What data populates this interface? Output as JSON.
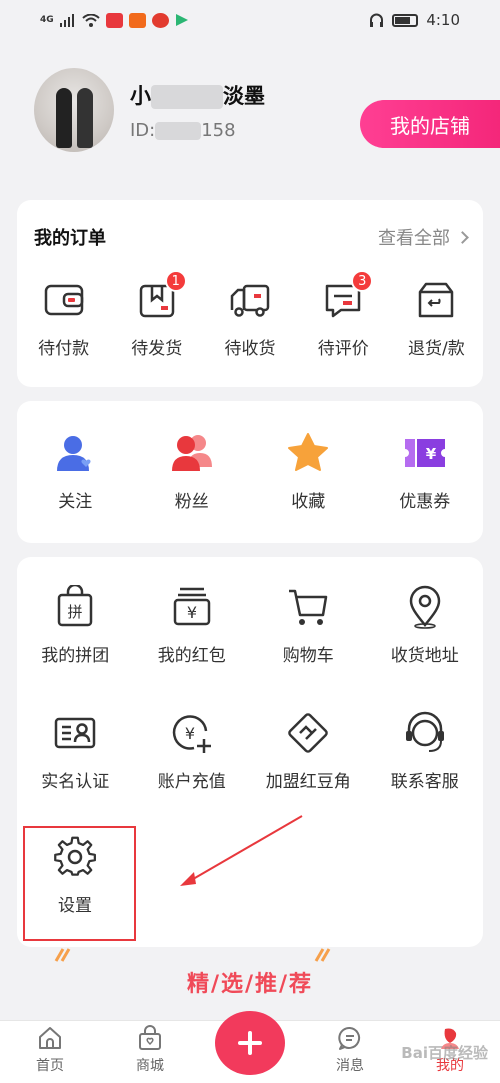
{
  "status_bar": {
    "network": "4G",
    "time": "4:10"
  },
  "profile": {
    "name_start": "小",
    "name_end": "淡墨",
    "id_prefix": "ID:",
    "id_suffix": "158",
    "shop_button": "我的店铺"
  },
  "orders": {
    "title": "我的订单",
    "view_all": "查看全部",
    "items": [
      {
        "label": "待付款",
        "icon": "wallet-icon",
        "badge": ""
      },
      {
        "label": "待发货",
        "icon": "package-icon",
        "badge": "1"
      },
      {
        "label": "待收货",
        "icon": "truck-icon",
        "badge": ""
      },
      {
        "label": "待评价",
        "icon": "comment-icon",
        "badge": "3"
      },
      {
        "label": "退货/款",
        "icon": "return-box-icon",
        "badge": ""
      }
    ]
  },
  "social": {
    "items": [
      {
        "label": "关注",
        "icon": "follow-user-icon"
      },
      {
        "label": "粉丝",
        "icon": "fans-icon"
      },
      {
        "label": "收藏",
        "icon": "star-icon"
      },
      {
        "label": "优惠券",
        "icon": "coupon-icon"
      }
    ]
  },
  "services": {
    "row1": [
      {
        "label": "我的拼团",
        "icon": "group-buy-icon"
      },
      {
        "label": "我的红包",
        "icon": "red-packet-icon"
      },
      {
        "label": "购物车",
        "icon": "cart-icon"
      },
      {
        "label": "收货地址",
        "icon": "location-icon"
      }
    ],
    "row2": [
      {
        "label": "实名认证",
        "icon": "id-card-icon"
      },
      {
        "label": "账户充值",
        "icon": "recharge-icon"
      },
      {
        "label": "加盟红豆角",
        "icon": "handshake-icon"
      },
      {
        "label": "联系客服",
        "icon": "headset-icon"
      }
    ],
    "row3": [
      {
        "label": "设置",
        "icon": "gear-icon"
      }
    ]
  },
  "featured": {
    "title": "精/选/推/荐"
  },
  "tabbar": {
    "items": [
      {
        "label": "首页",
        "icon": "home-icon"
      },
      {
        "label": "商城",
        "icon": "shop-bag-icon"
      },
      {
        "label": "",
        "icon": "plus-icon"
      },
      {
        "label": "消息",
        "icon": "message-icon"
      },
      {
        "label": "我的",
        "icon": "me-icon"
      }
    ]
  },
  "watermark": "Bai百度经验",
  "colors": {
    "accent": "#f23a5c",
    "brand_pink": "#ff3f93",
    "badge_red": "#f43b3b",
    "highlight_red": "#e8383d",
    "featured": "#f04a58"
  }
}
